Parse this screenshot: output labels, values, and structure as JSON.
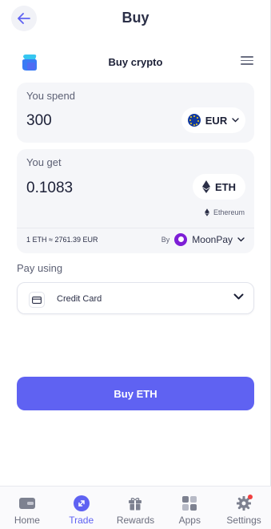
{
  "header": {
    "title": "Buy"
  },
  "widget": {
    "title": "Buy crypto"
  },
  "spend": {
    "label": "You spend",
    "amount": "300",
    "currency": "EUR"
  },
  "get": {
    "label": "You get",
    "amount": "0.1083",
    "currency": "ETH",
    "network": "Ethereum"
  },
  "rate": {
    "text": "1 ETH ≈ 2761.39 EUR"
  },
  "provider": {
    "by": "By",
    "name": "MoonPay"
  },
  "payment": {
    "label": "Pay using",
    "method": "Credit Card"
  },
  "buy_button": {
    "label": "Buy ETH"
  },
  "nav": {
    "items": [
      {
        "label": "Home",
        "icon": "wallet-icon"
      },
      {
        "label": "Trade",
        "icon": "trade-icon"
      },
      {
        "label": "Rewards",
        "icon": "gift-icon"
      },
      {
        "label": "Apps",
        "icon": "apps-icon"
      },
      {
        "label": "Settings",
        "icon": "gear-icon"
      }
    ],
    "active": "Trade"
  },
  "colors": {
    "accent": "#5f62f2",
    "notification": "#f04040"
  }
}
